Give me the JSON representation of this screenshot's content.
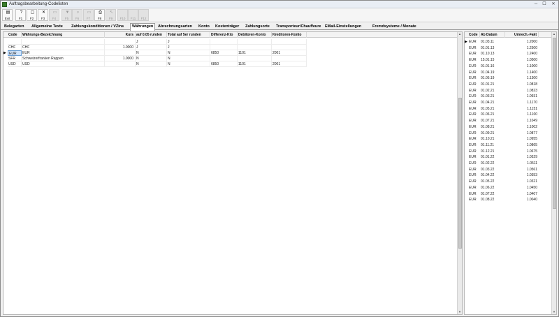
{
  "window": {
    "title": "Auftragsbearbeitung-Codelisten",
    "min": "─",
    "max": "☐",
    "close": "✕"
  },
  "toolbar": [
    {
      "label": "Exit",
      "icon": "▤",
      "disabled": false
    },
    {
      "label": "F1",
      "icon": "?",
      "disabled": false
    },
    {
      "label": "F2",
      "icon": "▢",
      "disabled": false
    },
    {
      "label": "F3",
      "icon": "✕",
      "disabled": false
    },
    {
      "label": "F4",
      "icon": "▭",
      "disabled": true
    },
    {
      "label": "F5",
      "icon": "▼",
      "disabled": true
    },
    {
      "label": "F6",
      "icon": "⌕",
      "disabled": true
    },
    {
      "label": "F7",
      "icon": "▭",
      "disabled": true
    },
    {
      "label": "F8",
      "icon": "⎙",
      "disabled": false
    },
    {
      "label": "F9",
      "icon": "↖",
      "disabled": true
    },
    {
      "label": "F10",
      "icon": "",
      "disabled": true
    },
    {
      "label": "F11",
      "icon": "",
      "disabled": true
    },
    {
      "label": "F12",
      "icon": "",
      "disabled": true
    }
  ],
  "tabs": [
    "Belegarten",
    "Allgemeine Texte",
    "Zahlungskonditionen / VZins",
    "Währungen",
    "Abrechnungsarten",
    "Konto",
    "Kostenträger",
    "Zahlungsorte",
    "Transporteur/Chauffeure",
    "EMail-Einstellungen",
    "Fremdsysteme / Monate"
  ],
  "active_tab": "Währungen",
  "left_grid": {
    "headers": [
      "Code",
      "Währungs-Bezeichnung",
      "Kurs",
      "auf 0.05 runden",
      "Total auf 5er runden",
      "Differenz-Kto",
      "Debitoren-Konto",
      "Kreditoren-Konto"
    ],
    "rows": [
      [
        "",
        "",
        "",
        "J",
        "J",
        "",
        "",
        ""
      ],
      [
        "CHF",
        "CHF",
        "1.0000",
        "J",
        "J",
        "",
        "",
        ""
      ],
      [
        "EUR",
        "EUR",
        "",
        "N",
        "N",
        "6850",
        "1101",
        "2001"
      ],
      [
        "SFR",
        "Schweizerfranken Rappen",
        "1.0000",
        "N",
        "N",
        "",
        "",
        ""
      ],
      [
        "USD",
        "USD",
        "",
        "N",
        "N",
        "6850",
        "1101",
        "2001"
      ]
    ],
    "selected_row": 2
  },
  "right_grid": {
    "headers": [
      "Code",
      "Ab Datum",
      "Umrech.-Fakt"
    ],
    "rows": [
      [
        "EUR",
        "01.03.11",
        "1.2000"
      ],
      [
        "EUR",
        "01.01.13",
        "1.2500"
      ],
      [
        "EUR",
        "01.10.13",
        "1.2400"
      ],
      [
        "EUR",
        "15.01.15",
        "1.0500"
      ],
      [
        "EUR",
        "01.01.16",
        "1.1000"
      ],
      [
        "EUR",
        "01.04.19",
        "1.1400"
      ],
      [
        "EUR",
        "01.05.19",
        "1.1300"
      ],
      [
        "EUR",
        "01.01.21",
        "1.0818"
      ],
      [
        "EUR",
        "01.02.21",
        "1.0823"
      ],
      [
        "EUR",
        "01.03.21",
        "1.0931"
      ],
      [
        "EUR",
        "01.04.21",
        "1.1170"
      ],
      [
        "EUR",
        "01.05.21",
        "1.1151"
      ],
      [
        "EUR",
        "01.06.21",
        "1.1100"
      ],
      [
        "EUR",
        "01.07.21",
        "1.1049"
      ],
      [
        "EUR",
        "01.08.21",
        "1.1002"
      ],
      [
        "EUR",
        "01.09.21",
        "1.0877"
      ],
      [
        "EUR",
        "01.10.21",
        "1.0955"
      ],
      [
        "EUR",
        "01.11.21",
        "1.0865"
      ],
      [
        "EUR",
        "01.12.21",
        "1.0675"
      ],
      [
        "EUR",
        "01.01.22",
        "1.0529"
      ],
      [
        "EUR",
        "01.02.22",
        "1.0511"
      ],
      [
        "EUR",
        "01.03.22",
        "1.0561"
      ],
      [
        "EUR",
        "01.04.22",
        "1.0353"
      ],
      [
        "EUR",
        "01.05.22",
        "1.0321"
      ],
      [
        "EUR",
        "01.06.22",
        "1.0450"
      ],
      [
        "EUR",
        "01.07.22",
        "1.0407"
      ],
      [
        "EUR",
        "01.08.22",
        "1.0040"
      ]
    ],
    "selected_row": 0
  }
}
